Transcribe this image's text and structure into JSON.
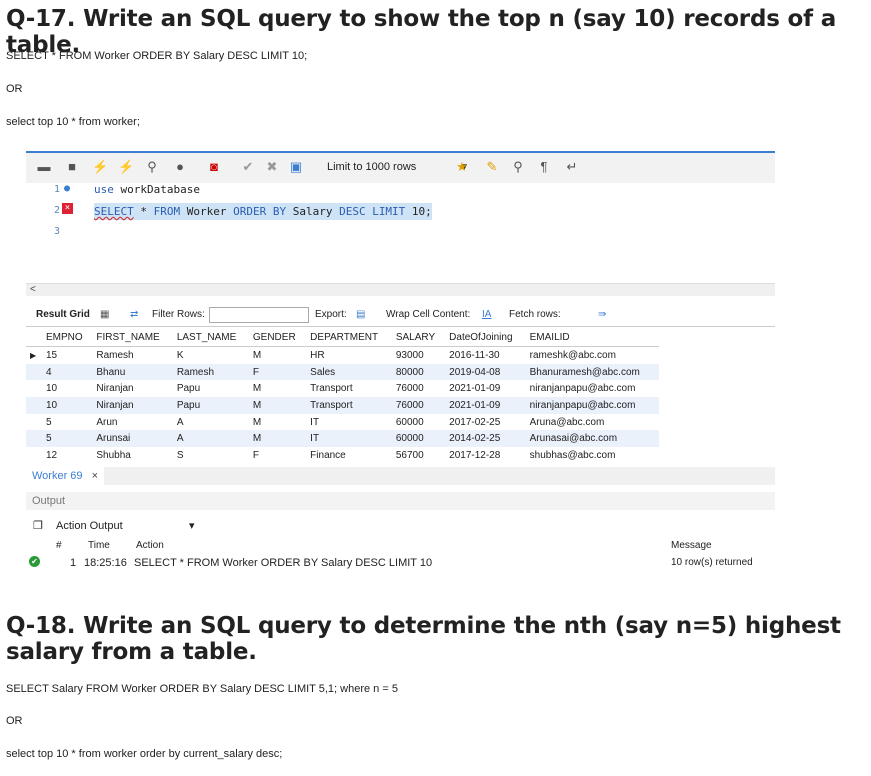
{
  "q17": {
    "title": "Q-17. Write an SQL query to show the top n (say 10) records of a table.",
    "line1": "SELECT * FROM Worker ORDER BY Salary DESC LIMIT 10;",
    "or": "OR",
    "line2": "select top 10 * from worker;"
  },
  "workbench": {
    "limit_label": "Limit to 1000 rows",
    "editor": {
      "lines": [
        {
          "num": "1",
          "text": "use workDatabase"
        },
        {
          "num": "2",
          "text": "SELECT * FROM Worker ORDER BY Salary DESC LIMIT 10;"
        },
        {
          "num": "3",
          "text": ""
        }
      ]
    },
    "scroll_left": "<",
    "result_bar": {
      "result_grid": "Result Grid",
      "filter_rows": "Filter Rows:",
      "export": "Export:",
      "wrap": "Wrap Cell Content:",
      "fetch": "Fetch rows:"
    },
    "columns": [
      "EMPNO",
      "FIRST_NAME",
      "LAST_NAME",
      "GENDER",
      "DEPARTMENT",
      "SALARY",
      "DateOfJoining",
      "EMAILID"
    ],
    "rows": [
      [
        "15",
        "Ramesh",
        "K",
        "M",
        "HR",
        "93000",
        "2016-11-30",
        "rameshk@abc.com"
      ],
      [
        "4",
        "Bhanu",
        "Ramesh",
        "F",
        "Sales",
        "80000",
        "2019-04-08",
        "Bhanuramesh@abc.com"
      ],
      [
        "10",
        "Niranjan",
        "Papu",
        "M",
        "Transport",
        "76000",
        "2021-01-09",
        "niranjanpapu@abc.com"
      ],
      [
        "10",
        "Niranjan",
        "Papu",
        "M",
        "Transport",
        "76000",
        "2021-01-09",
        "niranjanpapu@abc.com"
      ],
      [
        "5",
        "Arun",
        "A",
        "M",
        "IT",
        "60000",
        "2017-02-25",
        "Aruna@abc.com"
      ],
      [
        "5",
        "Arunsai",
        "A",
        "M",
        "IT",
        "60000",
        "2014-02-25",
        "Arunasai@abc.com"
      ],
      [
        "12",
        "Shubha",
        "S",
        "F",
        "Finance",
        "56700",
        "2017-12-28",
        "shubhas@abc.com"
      ]
    ],
    "tab_label": "Worker 69",
    "tab_close": "×",
    "output_label": "Output",
    "action_output": "Action Output",
    "output_headers": {
      "hash": "#",
      "time": "Time",
      "action": "Action",
      "message": "Message"
    },
    "output_row": {
      "num": "1",
      "time": "18:25:16",
      "action": "SELECT * FROM Worker ORDER BY Salary DESC LIMIT 10",
      "message": "10 row(s) returned"
    }
  },
  "q18": {
    "title": "Q-18. Write an SQL query to determine the nth (say n=5) highest salary from a table.",
    "line1": "SELECT Salary FROM Worker ORDER BY Salary DESC LIMIT 5,1; where n = 5",
    "or": "OR",
    "line2": "select top 10 * from worker order by current_salary desc;"
  }
}
